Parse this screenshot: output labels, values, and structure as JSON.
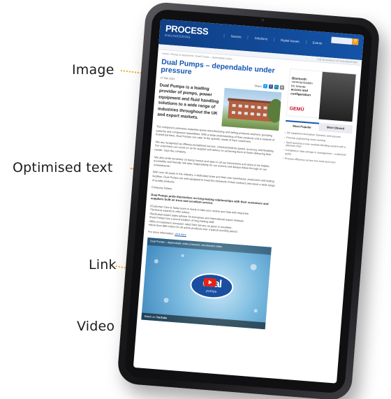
{
  "callouts": {
    "image": "Image",
    "optimised_text": "Optimised text",
    "link": "Link",
    "video": "Video"
  },
  "accent_color": "#F2A81F",
  "site": {
    "logo": "PROCESS",
    "logo_sub": "ENGINEERING",
    "nav": [
      "Sectors",
      "Solutions",
      "Digital Issues",
      "Events"
    ],
    "search_icon": "search-icon",
    "subbar_right": "THE BUSINESS OF ENGINEERING"
  },
  "article": {
    "breadcrumb": "Home / Pumps & equipment / Dual Pumps – dependable under...",
    "title": "Dual Pumps – dependable under pressure",
    "date": "27 Mar 2021",
    "share_label": "Share",
    "lead": "Dual Pumps is a leading provider of pumps, power equipment and fluid handling solutions to a wide range of industries throughout the UK and export markets.",
    "paragraphs": [
      "The company's extensive expertise spans manufacturing and selling pressure washers, pumping systems and component assemblies. With a deep understanding of their products and a network of trusted partners, Dual Pumps can cater to the specific needs of their customers.",
      "'We are recognised as offering exceptional service, characterised by speed, accuracy and flexibility. Our customers can count on us for support and advice on achieving them to finish delivering their needs,' says the company.",
      "'We also pride ourselves on being honest and open in all our interactions and strive to be helpful, accessible and friendly. We take responsibility for our actions and always follow through on our commitments.'",
      "With over 30 years in the industry, a dedicated team and their own warehouse, production and testing facilities, Dual Pumps are well equipped to meet the demands of their partners and stock a wide range of quality products.",
      "Company history"
    ],
    "subheading": "Dual Pumps pride themselves on long-lasting relationships with their customers and suppliers built on trust and excellent service.",
    "bullets": [
      "Customer Care & Sales team is ready to take your orders and help with enquiries.",
      "Technical experts to offer advice.",
      "Dedicated expert sales advisor for European and international export markets.",
      "Dual Pumps has a proud tradition of long-lasting staff.",
      "90% of customers surveyed, rated their service as good or excellent.",
      "More than 800 orders for all active products over a typical monthly period."
    ],
    "link_prefix": "For more information,",
    "link_text": "click here",
    "video": {
      "title": "Dual Pumps – dependable under pressure, introduction video",
      "brand": "dual",
      "brand_sub": "pumps",
      "watch_on": "Watch on",
      "platform": "YouTube"
    }
  },
  "sidebar": {
    "ad": {
      "line1": "Bluetooth",
      "line2": "communication",
      "line3": "for remote",
      "line4": "access and",
      "line5": "configuration",
      "brand": "GEMÜ"
    },
    "tabs": [
      "Most Popular",
      "Most Shared"
    ],
    "items": [
      "UK equipment innovation: Dynamic and success",
      "Process engineering news roundup",
      "Spirit launches a new modular blending system with a planned close",
      "Compliance risks emerge in management – a practical guide",
      "Process efficiency across new tools and more"
    ]
  }
}
